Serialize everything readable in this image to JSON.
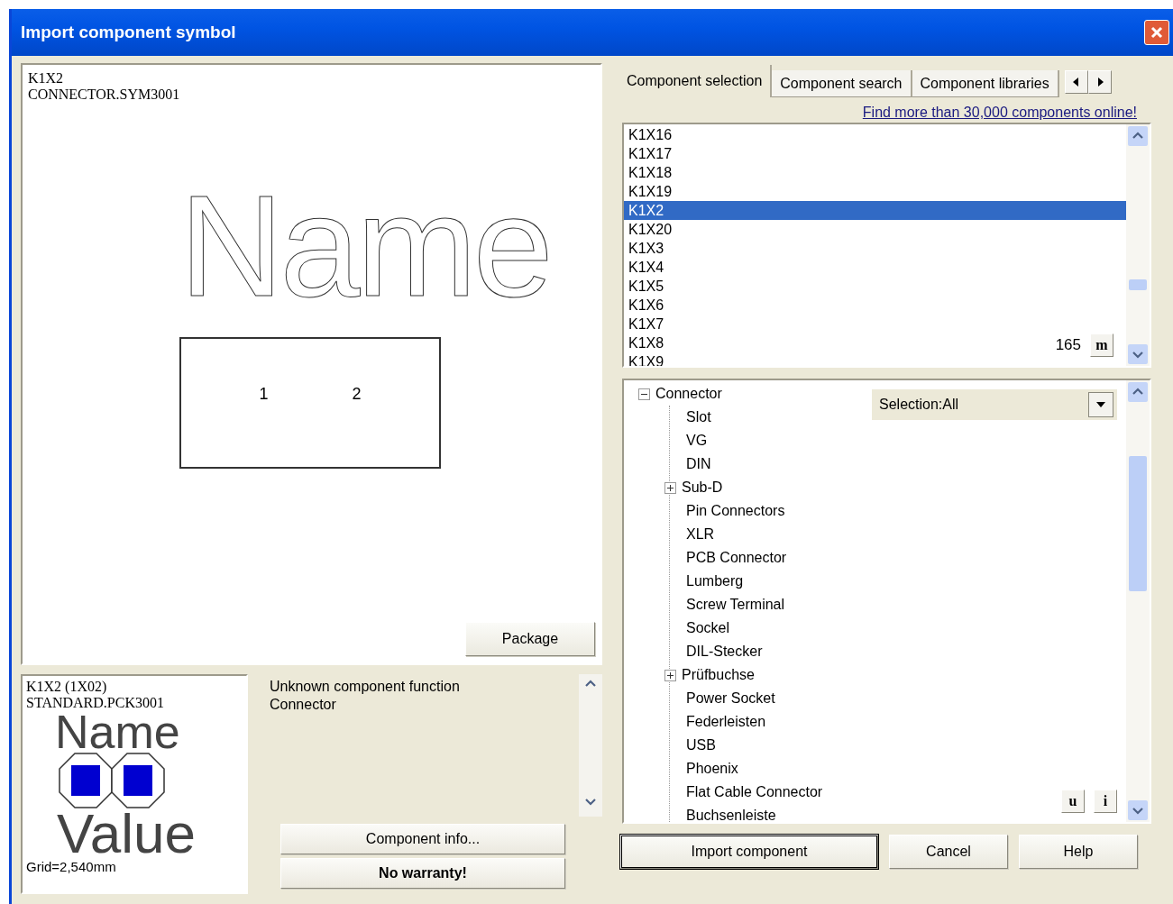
{
  "window": {
    "title": "Import component symbol"
  },
  "symbol_preview": {
    "name_line": "K1X2",
    "file": "CONNECTOR.SYM3001",
    "symbol_name": "Name",
    "pins": [
      "1",
      "2"
    ],
    "package_button": "Package"
  },
  "package_preview": {
    "name_line": "K1X2 (1X02)",
    "file": "STANDARD.PCK3001",
    "name": "Name",
    "value": "Value",
    "grid": "Grid=2,540mm"
  },
  "info": {
    "lines": [
      "Unknown component function",
      "Connector"
    ],
    "buttons": [
      {
        "label": "Component info...",
        "bold": false
      },
      {
        "label": "No warranty!",
        "bold": true
      }
    ]
  },
  "tabs": [
    {
      "label": "Component selection",
      "selected": true
    },
    {
      "label": "Component search",
      "selected": false
    },
    {
      "label": "Component libraries",
      "selected": false
    }
  ],
  "online_link": "Find more than 30,000 components online!",
  "component_list": {
    "count": "165",
    "count_button": "m",
    "items": [
      {
        "label": "K1X16",
        "selected": false
      },
      {
        "label": "K1X17",
        "selected": false
      },
      {
        "label": "K1X18",
        "selected": false
      },
      {
        "label": "K1X19",
        "selected": false
      },
      {
        "label": "K1X2",
        "selected": true
      },
      {
        "label": "K1X20",
        "selected": false
      },
      {
        "label": "K1X3",
        "selected": false
      },
      {
        "label": "K1X4",
        "selected": false
      },
      {
        "label": "K1X5",
        "selected": false
      },
      {
        "label": "K1X6",
        "selected": false
      },
      {
        "label": "K1X7",
        "selected": false
      },
      {
        "label": "K1X8",
        "selected": false
      },
      {
        "label": "K1X9",
        "selected": false
      }
    ]
  },
  "category_tree": {
    "selection": "Selection:All",
    "small_buttons": [
      "u",
      "i"
    ],
    "items": [
      {
        "label": "Connector",
        "expanded": true,
        "children": [
          {
            "label": "Slot"
          },
          {
            "label": "VG"
          },
          {
            "label": "DIN"
          },
          {
            "label": "Sub-D",
            "expanded": false
          },
          {
            "label": "Pin Connectors"
          },
          {
            "label": "XLR"
          },
          {
            "label": "PCB Connector"
          },
          {
            "label": "Lumberg"
          },
          {
            "label": "Screw Terminal"
          },
          {
            "label": "Sockel"
          },
          {
            "label": "DIL-Stecker"
          },
          {
            "label": "Prüfbuchse",
            "expanded": false
          },
          {
            "label": "Power Socket"
          },
          {
            "label": "Federleisten"
          },
          {
            "label": "USB"
          },
          {
            "label": "Phoenix"
          },
          {
            "label": "Flat Cable Connector"
          },
          {
            "label": "Buchsenleiste"
          }
        ]
      }
    ]
  },
  "buttons": [
    {
      "label": "Import component",
      "default": true
    },
    {
      "label": "Cancel",
      "default": false
    },
    {
      "label": "Help",
      "default": false
    }
  ]
}
